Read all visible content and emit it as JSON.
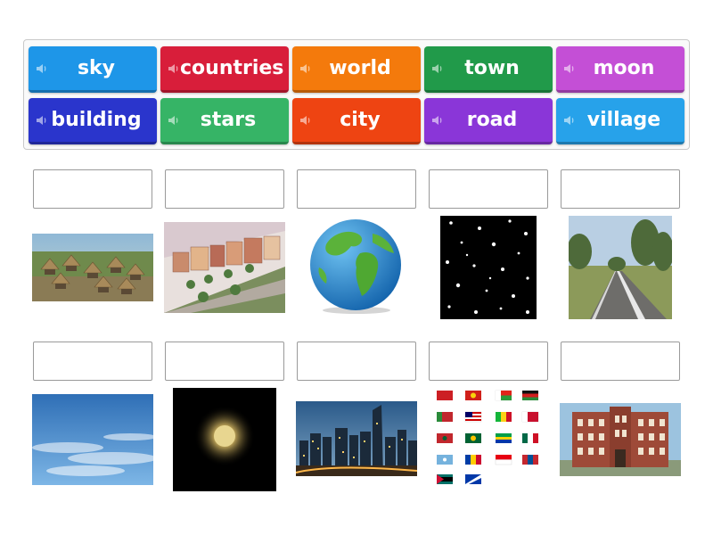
{
  "tiles": [
    {
      "label": "sky",
      "color": "#1e96e8"
    },
    {
      "label": "countries",
      "color": "#d81e3a"
    },
    {
      "label": "world",
      "color": "#f47a0c"
    },
    {
      "label": "town",
      "color": "#219a4a"
    },
    {
      "label": "moon",
      "color": "#c44fd6"
    },
    {
      "label": "building",
      "color": "#2a35cc"
    },
    {
      "label": "stars",
      "color": "#36b466"
    },
    {
      "label": "city",
      "color": "#ee4412"
    },
    {
      "label": "road",
      "color": "#8a36d8"
    },
    {
      "label": "village",
      "color": "#27a2ea"
    }
  ],
  "icons": {
    "speaker": "speaker-icon"
  },
  "pictures": [
    "village",
    "town",
    "globe",
    "stars",
    "road",
    "sky",
    "moon",
    "city",
    "flags",
    "building"
  ]
}
